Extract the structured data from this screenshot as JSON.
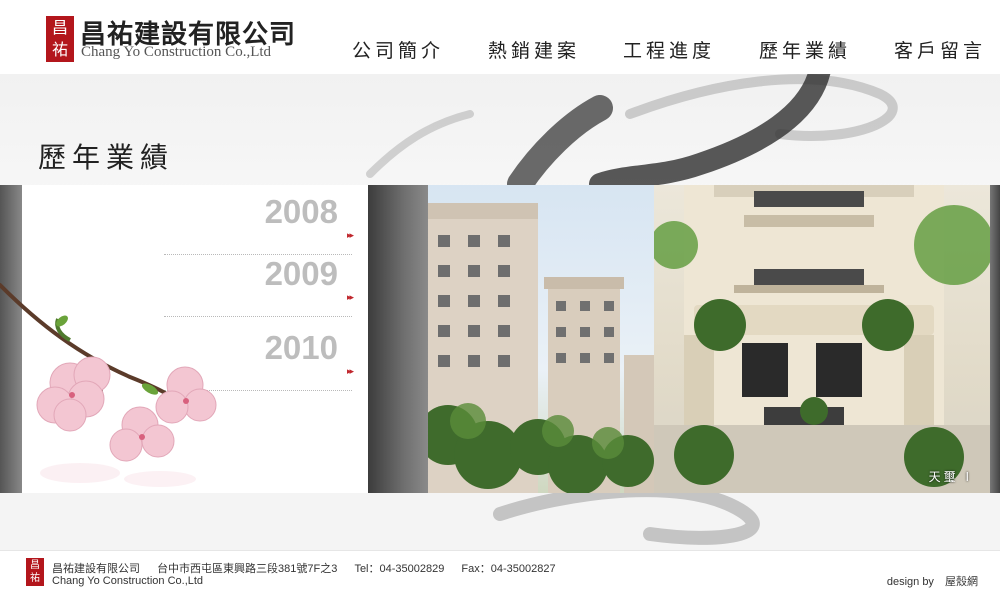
{
  "header": {
    "logo_seal": "昌祐",
    "company_name": "昌祐建設有限公司",
    "company_name_en": "Chang Yo Construction Co.,Ltd"
  },
  "nav": [
    {
      "label": "公司簡介"
    },
    {
      "label": "熱銷建案"
    },
    {
      "label": "工程進度"
    },
    {
      "label": "歷年業績"
    },
    {
      "label": "客戶留言"
    }
  ],
  "page": {
    "section_title": "歷年業績"
  },
  "years": [
    {
      "label": "2008",
      "arrow": "▸▸"
    },
    {
      "label": "2009",
      "arrow": "▸▸"
    },
    {
      "label": "2010",
      "arrow": "▸▸"
    }
  ],
  "photo": {
    "caption": "天璽 I"
  },
  "footer": {
    "seal": "昌祐",
    "company_name": "昌祐建設有限公司",
    "address": "台中市西屯區東興路三段381號7F之3",
    "tel": "Tel：04-35002829",
    "fax": "Fax：04-35002827",
    "company_name_en": "Chang Yo Construction Co.,Ltd",
    "design_by_label": "design by",
    "design_by_brand": "屋殼網"
  },
  "colors": {
    "seal_red": "#b3161c",
    "year_gray": "#bdbdbd",
    "arrow_red": "#c0272d"
  }
}
